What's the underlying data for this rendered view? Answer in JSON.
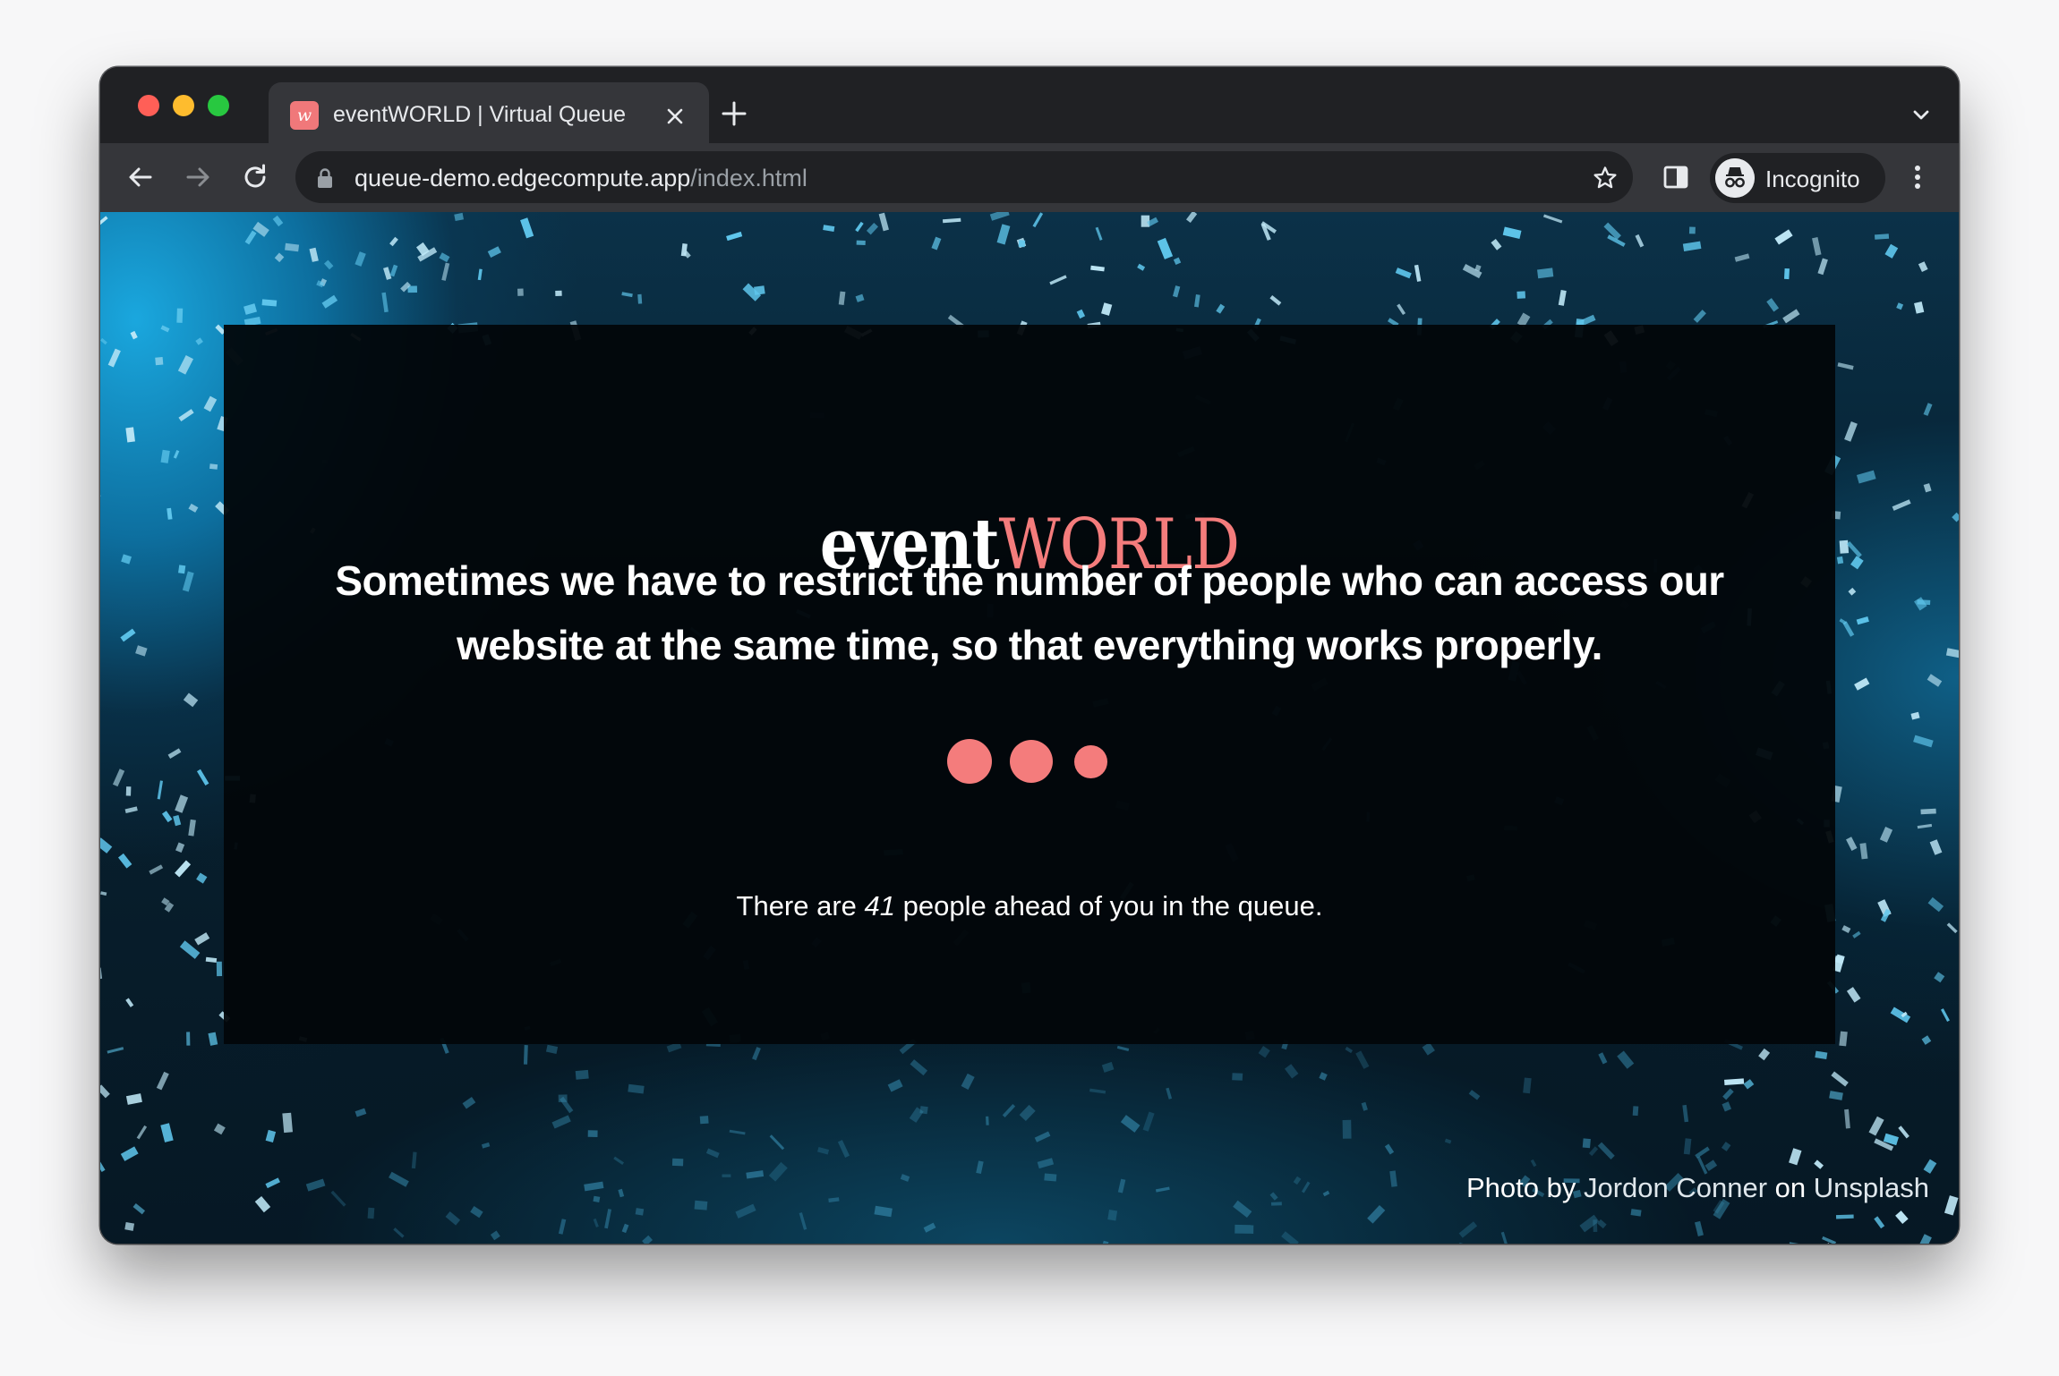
{
  "browser": {
    "tab": {
      "favicon_glyph": "w",
      "title": "eventWORLD | Virtual Queue"
    },
    "address_bar": {
      "host": "queue-demo.edgecompute.app",
      "path": "/index.html"
    },
    "profile": {
      "label": "Incognito"
    }
  },
  "page": {
    "logo": {
      "part1": "event",
      "part2": "WORLD"
    },
    "headline_line1": "Sometimes we have to restrict the number of people who can access our",
    "headline_line2": "website at the same time, so that everything works properly.",
    "queue": {
      "prefix": "There are ",
      "count": "41",
      "suffix": " people ahead of you in the queue."
    },
    "credit": {
      "prefix": "Photo by ",
      "author": "Jordon Conner",
      "middle": " on ",
      "source": "Unsplash"
    }
  },
  "colors": {
    "accent": "#f47c7c",
    "browser_frame": "#202124",
    "toolbar": "#35363a",
    "card_background": "#03070b",
    "page_background": "#0b3148"
  },
  "icons": [
    "close-icon",
    "plus-icon",
    "chevron-down-icon",
    "back-arrow-icon",
    "forward-arrow-icon",
    "reload-icon",
    "lock-icon",
    "star-icon",
    "side-panel-icon",
    "incognito-icon",
    "more-vert-icon"
  ]
}
